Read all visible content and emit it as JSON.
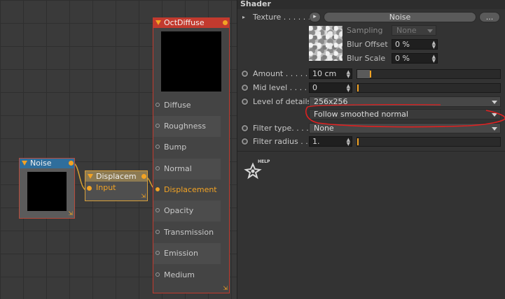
{
  "editor": {
    "noise_node": {
      "title": "Noise"
    },
    "displace_node": {
      "title": "Displacem",
      "input_label": "Input"
    },
    "oct_node": {
      "title": "OctDiffuse",
      "ports": [
        "Diffuse",
        "Roughness",
        "Bump",
        "Normal",
        "Displacement",
        "Opacity",
        "Transmission",
        "Emission",
        "Medium"
      ],
      "active_port": "Displacement"
    },
    "resize_glyph": "⇲"
  },
  "panel": {
    "title": "Shader",
    "texture": {
      "label": "Texture . . . . . .",
      "play_symbol": "▸",
      "value": "Noise",
      "more": "..."
    },
    "sampling": {
      "label": "Sampling",
      "value": "None"
    },
    "blur_offset": {
      "label": "Blur Offset",
      "value": "0 %"
    },
    "blur_scale": {
      "label": "Blur Scale",
      "value": "0 %"
    },
    "amount": {
      "label": "Amount . . . . .",
      "value": "10 cm"
    },
    "mid_level": {
      "label": "Mid level  . . . .",
      "value": "0"
    },
    "level_of_details": {
      "label": "Level of details",
      "value": "256x256"
    },
    "normal_mode": {
      "value": "Follow smoothed normal"
    },
    "filter_type": {
      "label": "Filter type. . . .",
      "value": "None"
    },
    "filter_radius": {
      "label": "Filter radius . .",
      "value": "1."
    },
    "help_label": "HELP",
    "spin_glyph": "▲▼"
  },
  "colors": {
    "accent": "#f2a324",
    "annotation": "#e02020",
    "oct_header": "#c23a2e",
    "noise_header": "#2f6e9c"
  },
  "icons": [
    "collapse-triangle-icon",
    "port-dot-icon",
    "resize-handle-icon",
    "radio-icon",
    "dropdown-arrow-icon",
    "help-icon"
  ]
}
